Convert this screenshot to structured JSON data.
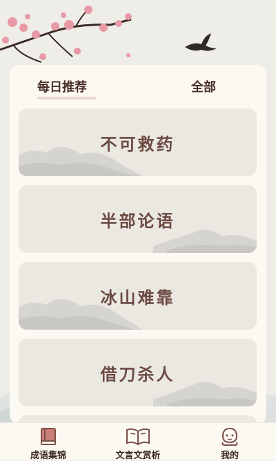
{
  "tabs": {
    "daily": "每日推荐",
    "all": "全部"
  },
  "cards": [
    {
      "title": "不可救药"
    },
    {
      "title": "半部论语"
    },
    {
      "title": "冰山难靠"
    },
    {
      "title": "借刀杀人"
    }
  ],
  "nav": [
    {
      "label": "成语集锦",
      "icon": "book-stack-icon"
    },
    {
      "label": "文言文赏析",
      "icon": "open-book-icon"
    },
    {
      "label": "我的",
      "icon": "user-face-icon"
    }
  ],
  "colors": {
    "accent": "#6b4a42",
    "panel": "#fbf9f2",
    "card": "#ebe8e2",
    "icon": "#7a4e47"
  }
}
